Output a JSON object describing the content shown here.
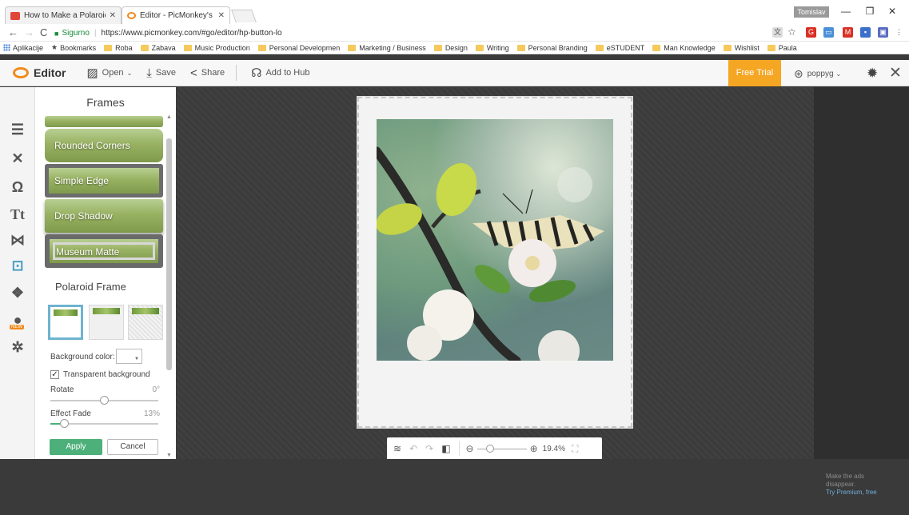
{
  "browser": {
    "tabs": [
      {
        "title": "How to Make a Polaroid",
        "favicon_color": "#e0463a"
      },
      {
        "title": "Editor - PicMonkey's Pho",
        "favicon_color": "#f08a1c"
      }
    ],
    "user_chip": "Tomislav",
    "address": {
      "secure_label": "Sigurno",
      "url": "https://www.picmonkey.com/#go/editor/hp-button-lo"
    },
    "bookmarks": [
      "Aplikacije",
      "Bookmarks",
      "Roba",
      "Zabava",
      "Music Production",
      "Personal Developmen",
      "Marketing / Business",
      "Design",
      "Writing",
      "Personal Branding",
      "eSTUDENT",
      "Man Knowledge",
      "Wishlist",
      "Paula"
    ]
  },
  "toolbar": {
    "logo": "Editor",
    "open": "Open",
    "save": "Save",
    "share": "Share",
    "add_to_hub": "Add to Hub",
    "free_trial": "Free Trial",
    "account": "poppyg"
  },
  "panel": {
    "title": "Frames",
    "frames": [
      "Rounded Corners",
      "Simple Edge",
      "Drop Shadow",
      "Museum Matte"
    ],
    "polaroid": {
      "title": "Polaroid Frame",
      "background_color_label": "Background color:",
      "transparent_label": "Transparent background",
      "transparent_checked": true,
      "rotate_label": "Rotate",
      "rotate_value": "0°",
      "rotate_fraction": 0.5,
      "fade_label": "Effect Fade",
      "fade_value": "13%",
      "fade_fraction": 0.13,
      "apply": "Apply",
      "cancel": "Cancel"
    }
  },
  "zoom": {
    "value": "19.4%",
    "fraction": 0.27
  },
  "ad": {
    "line1": "Make the ads",
    "line2": "disappear.",
    "link": "Try Premium, free"
  },
  "colors": {
    "accent_orange": "#f5a623",
    "apply_green": "#4db07a",
    "selected_blue": "#6fb3d0"
  }
}
